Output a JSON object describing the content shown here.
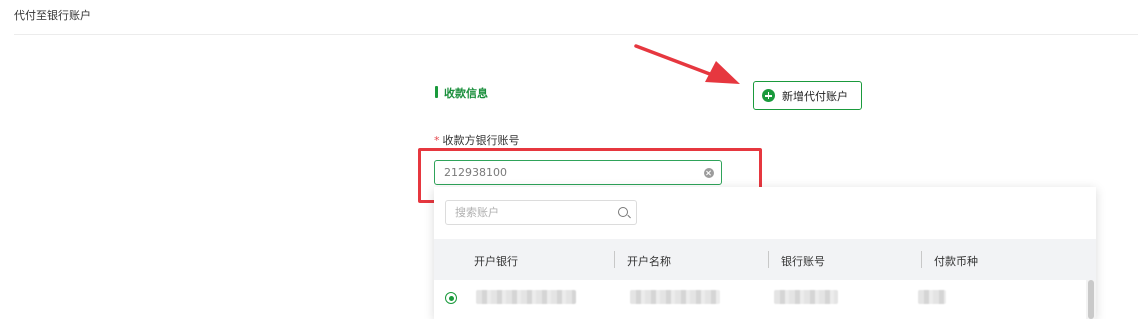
{
  "page": {
    "title": "代付至银行账户"
  },
  "section": {
    "title": "收款信息"
  },
  "add_button": {
    "label": "新增代付账户",
    "color": "#1a9a3c"
  },
  "account_field": {
    "required_mark": "*",
    "label": "收款方银行账号",
    "value": "212938100"
  },
  "dropdown": {
    "search_placeholder": "搜索账户",
    "columns": [
      "开户银行",
      "开户名称",
      "银行账号",
      "付款币种"
    ],
    "rows": [
      {
        "selected": true,
        "blurred": true
      }
    ]
  },
  "annotations": {
    "highlight_color": "#e6373f",
    "arrow_color": "#e6373f"
  }
}
